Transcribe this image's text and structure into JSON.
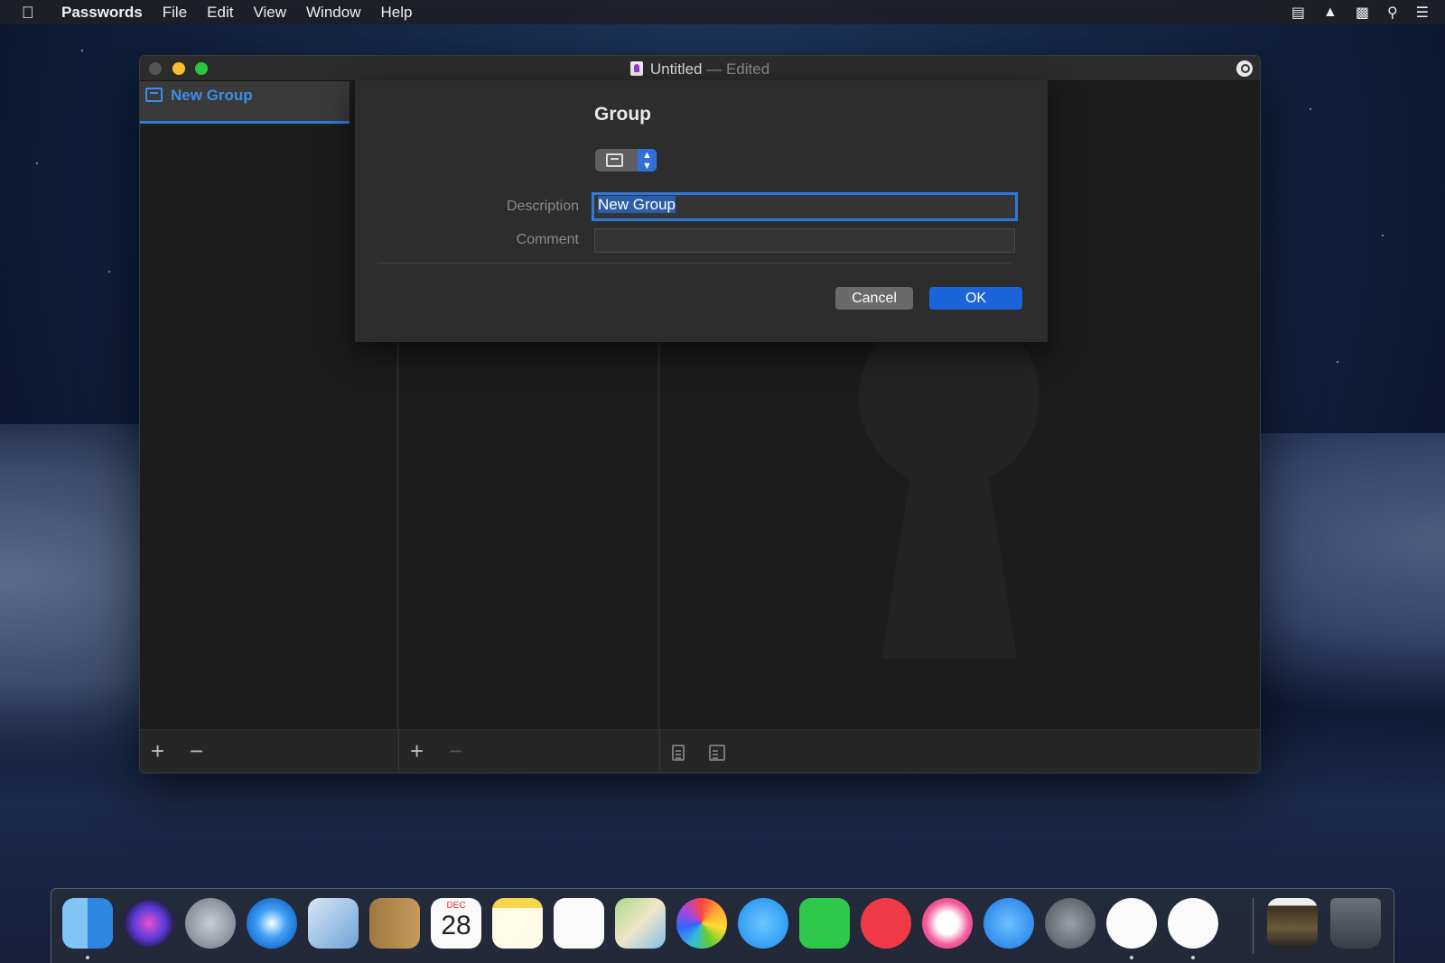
{
  "menubar": {
    "apple_icon": "apple-icon",
    "app_name": "Passwords",
    "menus": [
      "File",
      "Edit",
      "View",
      "Window",
      "Help"
    ],
    "status_icons": [
      "notifications-icon",
      "airplay-icon",
      "display-icon",
      "spotlight-icon",
      "list-icon"
    ]
  },
  "window": {
    "title": "Untitled",
    "title_suffix": "— Edited",
    "sidebar": {
      "groups": [
        {
          "label": "New Group",
          "icon": "archive-box-icon",
          "selected": true
        }
      ]
    },
    "bottombar": {
      "add_symbol": "+",
      "remove_symbol": "−",
      "entry_add_symbol": "+",
      "entry_remove_symbol": "−"
    }
  },
  "sheet": {
    "title": "Group",
    "icon_popup": "archive-box-icon",
    "description_label": "Description",
    "description_value": "New Group",
    "comment_label": "Comment",
    "comment_value": "",
    "cancel_label": "Cancel",
    "ok_label": "OK",
    "accent_color": "#1b64dc"
  },
  "dock": {
    "items": [
      {
        "name": "finder",
        "running": true
      },
      {
        "name": "siri",
        "running": false
      },
      {
        "name": "launchpad",
        "running": false
      },
      {
        "name": "safari",
        "running": false
      },
      {
        "name": "mail",
        "running": false
      },
      {
        "name": "contacts",
        "running": false
      },
      {
        "name": "calendar",
        "running": false,
        "month": "DEC",
        "day": "28"
      },
      {
        "name": "notes",
        "running": false
      },
      {
        "name": "reminders",
        "running": false
      },
      {
        "name": "maps",
        "running": false
      },
      {
        "name": "photos",
        "running": false
      },
      {
        "name": "messages",
        "running": false
      },
      {
        "name": "facetime",
        "running": false
      },
      {
        "name": "news",
        "running": false
      },
      {
        "name": "itunes",
        "running": false
      },
      {
        "name": "app-store",
        "running": false
      },
      {
        "name": "system-preferences",
        "running": false
      },
      {
        "name": "pencil-app",
        "running": true
      },
      {
        "name": "passwords",
        "running": true
      },
      {
        "name": "photo-stack",
        "running": false
      },
      {
        "name": "trash",
        "running": false
      }
    ]
  }
}
